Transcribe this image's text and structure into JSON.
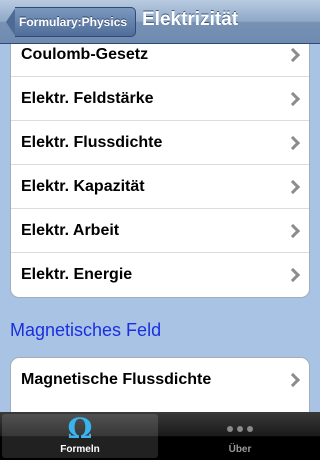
{
  "navbar": {
    "back_label": "Formulary:Physics",
    "title": "Elektrizität"
  },
  "group1": {
    "items": [
      {
        "label": "Coulomb-Gesetz"
      },
      {
        "label": "Elektr. Feldstärke"
      },
      {
        "label": "Elektr. Flussdichte"
      },
      {
        "label": "Elektr. Kapazität"
      },
      {
        "label": "Elektr. Arbeit"
      },
      {
        "label": "Elektr. Energie"
      }
    ]
  },
  "section2": {
    "header": "Magnetisches Feld",
    "items": [
      {
        "label": "Magnetische Flussdichte"
      }
    ]
  },
  "tabbar": {
    "tabs": [
      {
        "label": "Formeln",
        "icon": "omega-icon",
        "active": true
      },
      {
        "label": "Über",
        "icon": "more-icon",
        "active": false
      }
    ]
  },
  "colors": {
    "background": "#a9c3e4",
    "section_header": "#1a2fe0",
    "active_icon": "#3ab4f0"
  }
}
